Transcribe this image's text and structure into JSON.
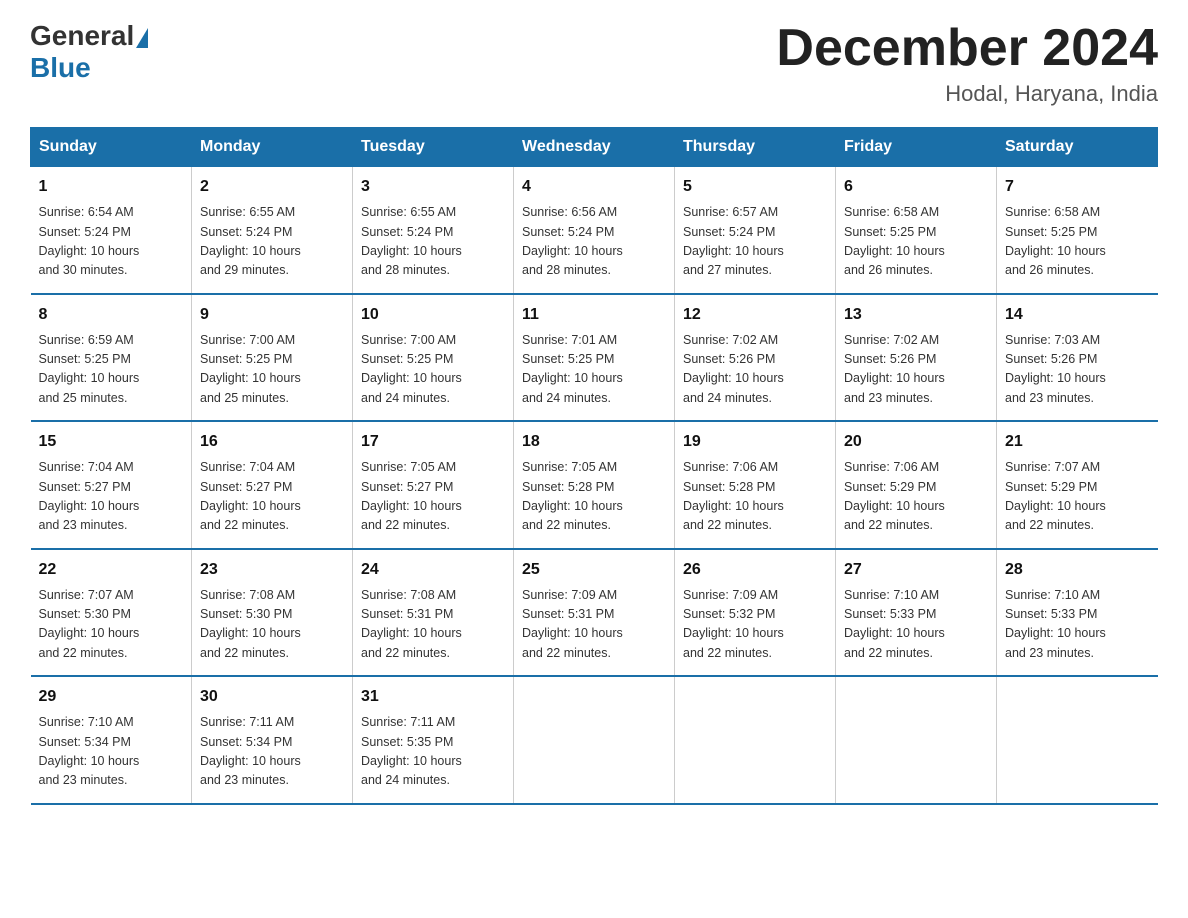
{
  "header": {
    "logo_general": "General",
    "logo_blue": "Blue",
    "month_title": "December 2024",
    "location": "Hodal, Haryana, India"
  },
  "days_of_week": [
    "Sunday",
    "Monday",
    "Tuesday",
    "Wednesday",
    "Thursday",
    "Friday",
    "Saturday"
  ],
  "weeks": [
    [
      {
        "day": "1",
        "info": "Sunrise: 6:54 AM\nSunset: 5:24 PM\nDaylight: 10 hours\nand 30 minutes."
      },
      {
        "day": "2",
        "info": "Sunrise: 6:55 AM\nSunset: 5:24 PM\nDaylight: 10 hours\nand 29 minutes."
      },
      {
        "day": "3",
        "info": "Sunrise: 6:55 AM\nSunset: 5:24 PM\nDaylight: 10 hours\nand 28 minutes."
      },
      {
        "day": "4",
        "info": "Sunrise: 6:56 AM\nSunset: 5:24 PM\nDaylight: 10 hours\nand 28 minutes."
      },
      {
        "day": "5",
        "info": "Sunrise: 6:57 AM\nSunset: 5:24 PM\nDaylight: 10 hours\nand 27 minutes."
      },
      {
        "day": "6",
        "info": "Sunrise: 6:58 AM\nSunset: 5:25 PM\nDaylight: 10 hours\nand 26 minutes."
      },
      {
        "day": "7",
        "info": "Sunrise: 6:58 AM\nSunset: 5:25 PM\nDaylight: 10 hours\nand 26 minutes."
      }
    ],
    [
      {
        "day": "8",
        "info": "Sunrise: 6:59 AM\nSunset: 5:25 PM\nDaylight: 10 hours\nand 25 minutes."
      },
      {
        "day": "9",
        "info": "Sunrise: 7:00 AM\nSunset: 5:25 PM\nDaylight: 10 hours\nand 25 minutes."
      },
      {
        "day": "10",
        "info": "Sunrise: 7:00 AM\nSunset: 5:25 PM\nDaylight: 10 hours\nand 24 minutes."
      },
      {
        "day": "11",
        "info": "Sunrise: 7:01 AM\nSunset: 5:25 PM\nDaylight: 10 hours\nand 24 minutes."
      },
      {
        "day": "12",
        "info": "Sunrise: 7:02 AM\nSunset: 5:26 PM\nDaylight: 10 hours\nand 24 minutes."
      },
      {
        "day": "13",
        "info": "Sunrise: 7:02 AM\nSunset: 5:26 PM\nDaylight: 10 hours\nand 23 minutes."
      },
      {
        "day": "14",
        "info": "Sunrise: 7:03 AM\nSunset: 5:26 PM\nDaylight: 10 hours\nand 23 minutes."
      }
    ],
    [
      {
        "day": "15",
        "info": "Sunrise: 7:04 AM\nSunset: 5:27 PM\nDaylight: 10 hours\nand 23 minutes."
      },
      {
        "day": "16",
        "info": "Sunrise: 7:04 AM\nSunset: 5:27 PM\nDaylight: 10 hours\nand 22 minutes."
      },
      {
        "day": "17",
        "info": "Sunrise: 7:05 AM\nSunset: 5:27 PM\nDaylight: 10 hours\nand 22 minutes."
      },
      {
        "day": "18",
        "info": "Sunrise: 7:05 AM\nSunset: 5:28 PM\nDaylight: 10 hours\nand 22 minutes."
      },
      {
        "day": "19",
        "info": "Sunrise: 7:06 AM\nSunset: 5:28 PM\nDaylight: 10 hours\nand 22 minutes."
      },
      {
        "day": "20",
        "info": "Sunrise: 7:06 AM\nSunset: 5:29 PM\nDaylight: 10 hours\nand 22 minutes."
      },
      {
        "day": "21",
        "info": "Sunrise: 7:07 AM\nSunset: 5:29 PM\nDaylight: 10 hours\nand 22 minutes."
      }
    ],
    [
      {
        "day": "22",
        "info": "Sunrise: 7:07 AM\nSunset: 5:30 PM\nDaylight: 10 hours\nand 22 minutes."
      },
      {
        "day": "23",
        "info": "Sunrise: 7:08 AM\nSunset: 5:30 PM\nDaylight: 10 hours\nand 22 minutes."
      },
      {
        "day": "24",
        "info": "Sunrise: 7:08 AM\nSunset: 5:31 PM\nDaylight: 10 hours\nand 22 minutes."
      },
      {
        "day": "25",
        "info": "Sunrise: 7:09 AM\nSunset: 5:31 PM\nDaylight: 10 hours\nand 22 minutes."
      },
      {
        "day": "26",
        "info": "Sunrise: 7:09 AM\nSunset: 5:32 PM\nDaylight: 10 hours\nand 22 minutes."
      },
      {
        "day": "27",
        "info": "Sunrise: 7:10 AM\nSunset: 5:33 PM\nDaylight: 10 hours\nand 22 minutes."
      },
      {
        "day": "28",
        "info": "Sunrise: 7:10 AM\nSunset: 5:33 PM\nDaylight: 10 hours\nand 23 minutes."
      }
    ],
    [
      {
        "day": "29",
        "info": "Sunrise: 7:10 AM\nSunset: 5:34 PM\nDaylight: 10 hours\nand 23 minutes."
      },
      {
        "day": "30",
        "info": "Sunrise: 7:11 AM\nSunset: 5:34 PM\nDaylight: 10 hours\nand 23 minutes."
      },
      {
        "day": "31",
        "info": "Sunrise: 7:11 AM\nSunset: 5:35 PM\nDaylight: 10 hours\nand 24 minutes."
      },
      {
        "day": "",
        "info": ""
      },
      {
        "day": "",
        "info": ""
      },
      {
        "day": "",
        "info": ""
      },
      {
        "day": "",
        "info": ""
      }
    ]
  ]
}
